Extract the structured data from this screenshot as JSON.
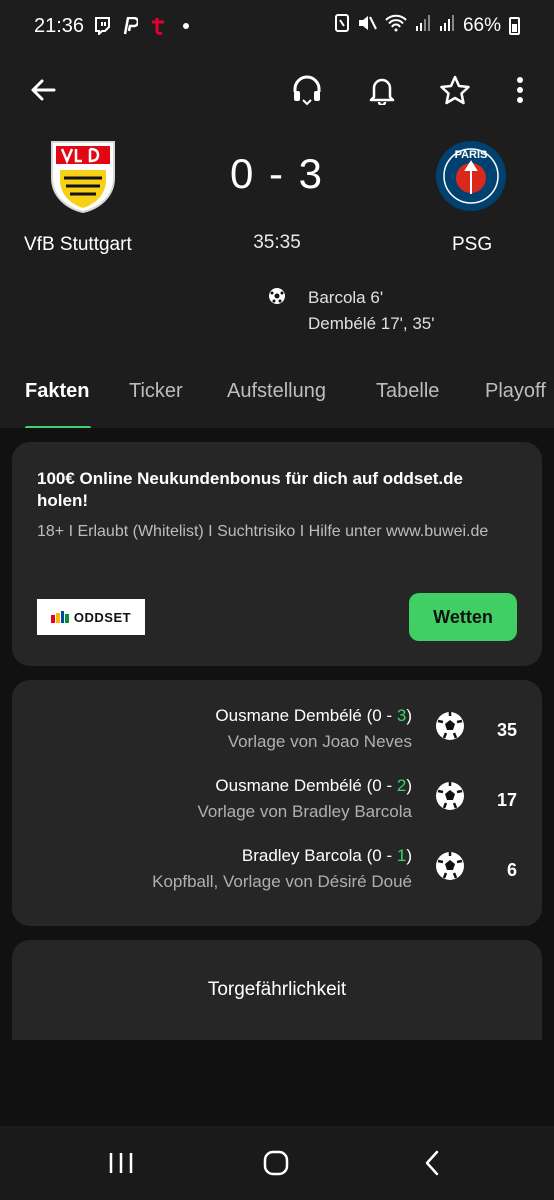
{
  "status_bar": {
    "time": "21:36",
    "battery": "66%",
    "left_icons": [
      "twitch-icon",
      "paypal-icon",
      "t-online-icon",
      "dot-icon"
    ],
    "right_icons": [
      "nfc-icon",
      "mute-icon",
      "wifi-icon",
      "signal-icon",
      "signal-icon"
    ]
  },
  "toolbar": {
    "icons": [
      "back-arrow-icon",
      "headset-icon",
      "bell-icon",
      "star-icon",
      "more-vert-icon"
    ]
  },
  "match": {
    "home_team": "VfB Stuttgart",
    "away_team": "PSG",
    "score": "0 - 3",
    "clock": "35:35",
    "scorers": [
      "Barcola 6'",
      "Dembélé 17', 35'"
    ]
  },
  "tabs": [
    {
      "label": "Fakten",
      "active": true
    },
    {
      "label": "Ticker",
      "active": false
    },
    {
      "label": "Aufstellung",
      "active": false
    },
    {
      "label": "Tabelle",
      "active": false
    },
    {
      "label": "Playoff",
      "active": false
    }
  ],
  "promo": {
    "title": "100€ Online Neukundenbonus für dich auf oddset.de holen!",
    "subtitle": "18+ I Erlaubt (Whitelist) I Suchtrisiko I Hilfe unter www.buwei.de",
    "logo_text": "ODDSET",
    "button_label": "Wetten"
  },
  "goals": [
    {
      "player": "Ousmane Dembélé",
      "score_prefix": "(0 - ",
      "score_new": "3",
      "score_suffix": ")",
      "detail": "Vorlage von Joao Neves",
      "minute": "35"
    },
    {
      "player": "Ousmane Dembélé",
      "score_prefix": "(0 - ",
      "score_new": "2",
      "score_suffix": ")",
      "detail": "Vorlage von Bradley Barcola",
      "minute": "17"
    },
    {
      "player": "Bradley Barcola",
      "score_prefix": "(0 - ",
      "score_new": "1",
      "score_suffix": ")",
      "detail": "Kopfball, Vorlage von Désiré Doué",
      "minute": "6"
    }
  ],
  "torgefahr": {
    "title": "Torgefährlichkeit"
  },
  "colors": {
    "accent": "#3dd26b",
    "background": "#1d1d1d",
    "card": "#262626",
    "content_bg": "#111111"
  }
}
